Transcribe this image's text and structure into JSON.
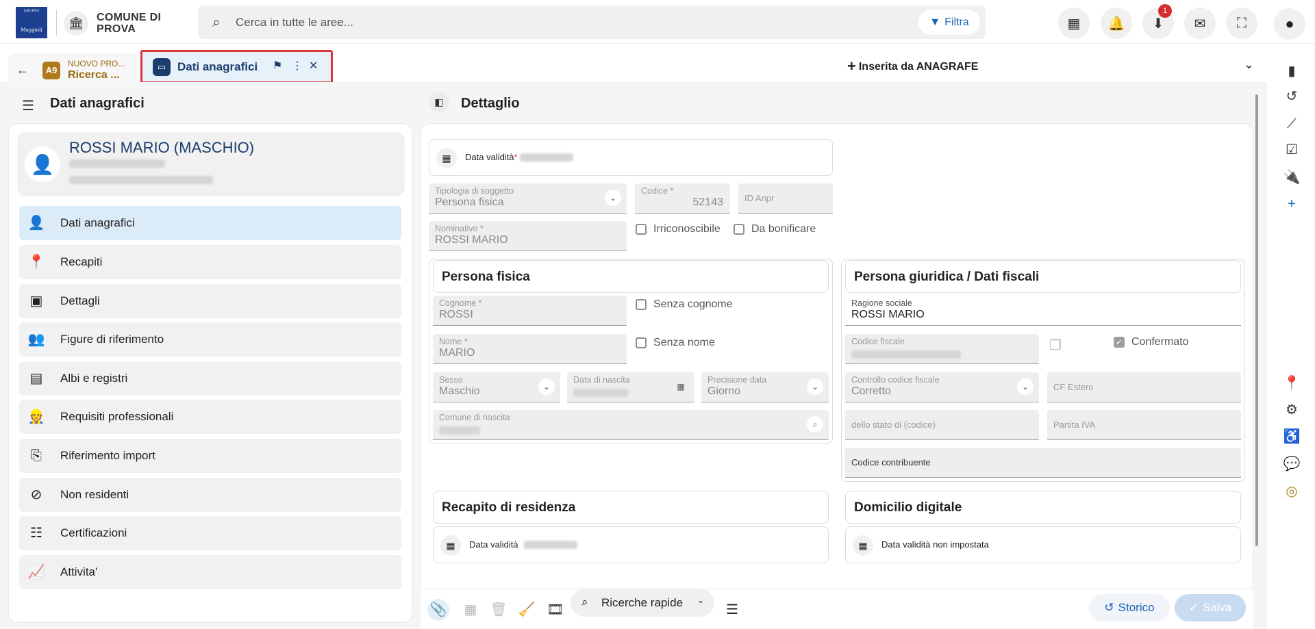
{
  "header": {
    "logo_small": "GRUPPO",
    "logo_text": "Maggioli",
    "comune_name": "COMUNE DI PROVA",
    "search_placeholder": "Cerca in tutte le aree...",
    "filter_label": "Filtra",
    "download_badge": "1"
  },
  "tabs": {
    "prev_small": "NUOVO PRO...",
    "prev_big": "Ricerca ...",
    "prev_app_badge": "A9",
    "active_label": "Dati anagrafici"
  },
  "left": {
    "title": "Dati anagrafici",
    "person_name": "ROSSI MARIO (MASCHIO)",
    "nav": [
      {
        "label": "Dati anagrafici",
        "icon": "person-icon"
      },
      {
        "label": "Recapiti",
        "icon": "location-icon"
      },
      {
        "label": "Dettagli",
        "icon": "badge-icon"
      },
      {
        "label": "Figure di riferimento",
        "icon": "people-icon"
      },
      {
        "label": "Albi e registri",
        "icon": "documents-icon"
      },
      {
        "label": "Requisiti professionali",
        "icon": "worker-icon"
      },
      {
        "label": "Riferimento import",
        "icon": "import-icon"
      },
      {
        "label": "Non residenti",
        "icon": "location-off-icon"
      },
      {
        "label": "Certificazioni",
        "icon": "list-doc-icon"
      },
      {
        "label": "Attivita'",
        "icon": "trending-icon"
      }
    ]
  },
  "detail": {
    "title": "Dettaglio",
    "data_validita": "Data validità",
    "inserted": "Inserita da ANAGRAFE",
    "tipologia_label": "Tipologia di soggetto",
    "tipologia_value": "Persona fisica",
    "codice_label": "Codice",
    "codice_value": "52143",
    "id_anpr": "ID Anpr",
    "nominativo_label": "Nominativo",
    "nominativo_value": "ROSSI MARIO",
    "irriconoscibile": "Irriconoscibile",
    "da_bonificare": "Da bonificare",
    "persona_fisica": {
      "title": "Persona fisica",
      "cognome_label": "Cognome",
      "cognome_value": "ROSSI",
      "senza_cognome": "Senza cognome",
      "nome_label": "Nome",
      "nome_value": "MARIO",
      "senza_nome": "Senza nome",
      "sesso_label": "Sesso",
      "sesso_value": "Maschio",
      "data_nascita_label": "Data di nascita",
      "precisione_label": "Precisione data",
      "precisione_value": "Giorno",
      "comune_nascita_label": "Comune di nascita"
    },
    "persona_giuridica": {
      "title": "Persona giuridica / Dati fiscali",
      "ragione_label": "Ragione sociale",
      "ragione_value": "ROSSI MARIO",
      "cf_label": "Codice fiscale",
      "confermato": "Confermato",
      "controllo_label": "Controllo codice fiscale",
      "controllo_value": "Corretto",
      "cf_estero": "CF Estero",
      "stato_codice": "dello stato di (codice)",
      "partita_iva": "Partita IVA",
      "codice_contribuente": "Codice contribuente"
    },
    "recapito_title": "Recapito di residenza",
    "recapito_data": "Data validità",
    "domicilio_title": "Domicilio digitale",
    "domicilio_data": "Data validità non impostata"
  },
  "toolbar": {
    "quick_search": "Ricerche rapide",
    "storico": "Storico",
    "salva": "Salva"
  },
  "colors": {
    "accent": "#1865b5",
    "brand_dark": "#1b3d6d",
    "highlight_border": "#e03535",
    "app_badge": "#b07a1c"
  }
}
